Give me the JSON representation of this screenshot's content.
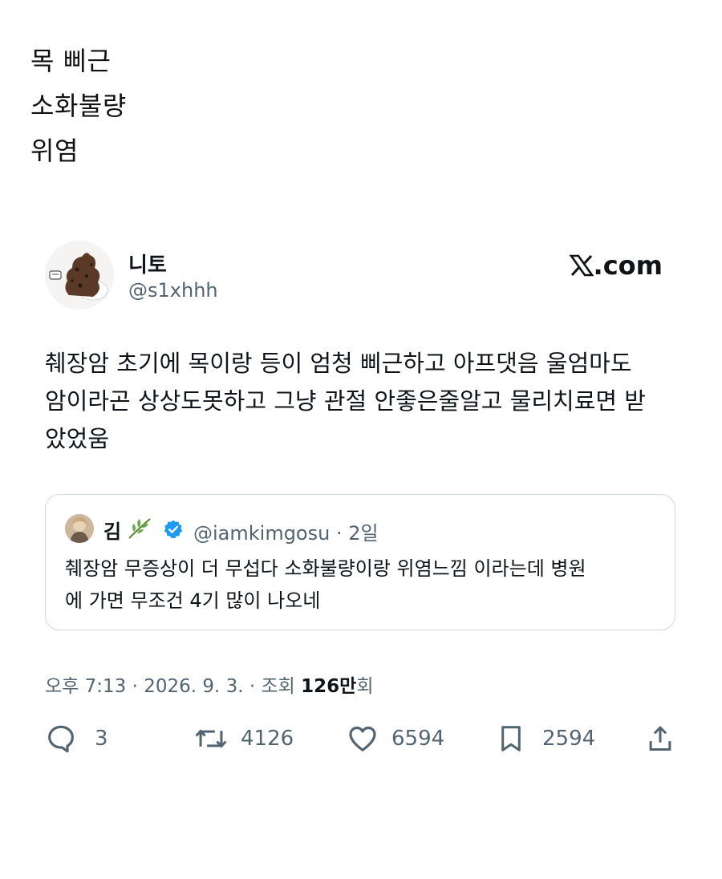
{
  "header_lines": [
    "목 삐근",
    "소화불량",
    "위염"
  ],
  "tweet": {
    "author_name": "니토",
    "author_handle": "@s1xhhh",
    "brand": "X.com",
    "brand_rest": ".com",
    "text": "췌장암 초기에 목이랑 등이 엄청 삐근하고 아프댓음 울엄마도\n암이라곤 상상도못하고 그냥 관절 안좋은줄알고 물리치료면 받\n았었움",
    "quote": {
      "name": "김",
      "handle": "@iamkimgosu",
      "time": "· 2일",
      "text": "췌장암 무증상이 더 무섭다 소화불량이랑 위염느낌 이라는데 병원\n에 가면 무조건 4기 많이 나오네"
    },
    "meta_prefix": "오후 7:13 · 2026. 9. 3. · 조회 ",
    "views": "126만",
    "views_suffix": "회",
    "actions": {
      "replies": "3",
      "retweets": "4126",
      "likes": "6594",
      "bookmarks": "2594"
    }
  },
  "colors": {
    "text": "#0f1419",
    "secondary": "#536471",
    "border": "#cfd9de",
    "verified": "#1d9bf0"
  },
  "icons": [
    "poop-avatar",
    "x-logo-icon",
    "leaf-icon",
    "verified-badge-icon",
    "reply-icon",
    "retweet-icon",
    "like-icon",
    "bookmark-icon",
    "share-icon"
  ]
}
